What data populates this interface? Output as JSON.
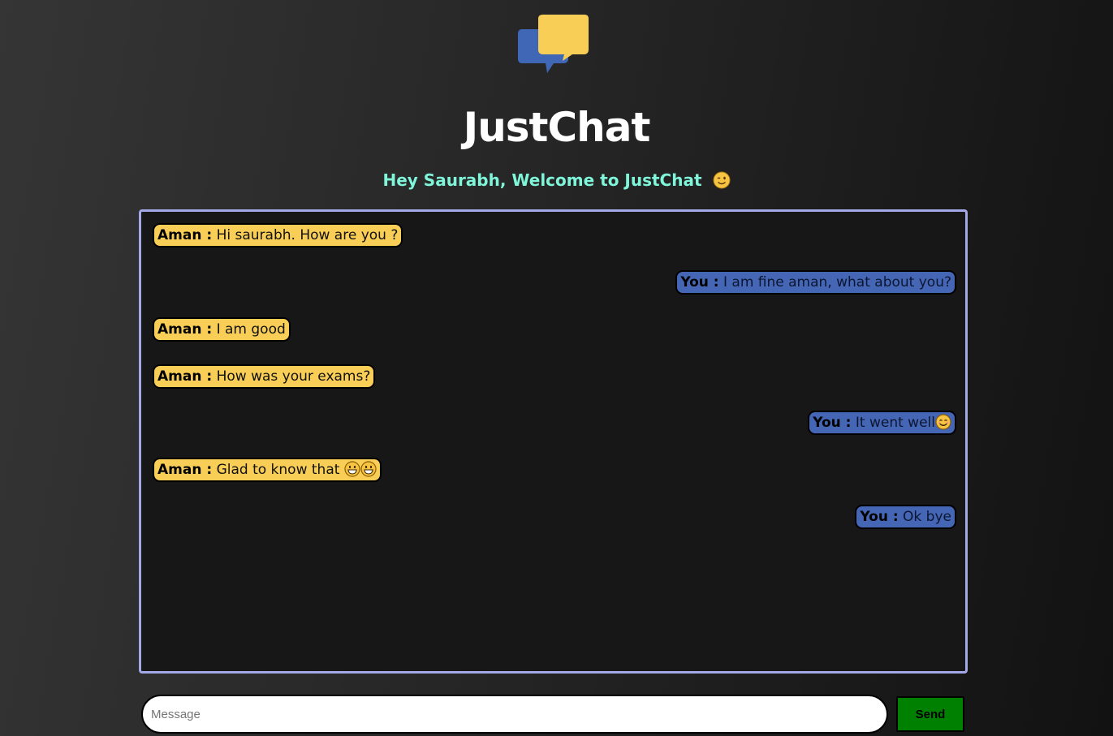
{
  "app": {
    "title": "JustChat",
    "welcome": "Hey Saurabh, Welcome to JustChat",
    "welcome_icon": "wink-emoji-icon",
    "logo_icon": "chat-bubbles-logo-icon"
  },
  "colors": {
    "welcome_text": "#7ff5d9",
    "chat_border": "#a3a8e6",
    "incoming_bubble": "#f9ce56",
    "outgoing_bubble": "#4466b5",
    "send_button": "#008000"
  },
  "messages": [
    {
      "side": "left",
      "sender": "Aman :",
      "text": "Hi saurabh. How are you ?",
      "emojis": []
    },
    {
      "side": "right",
      "sender": "You :",
      "text": "I am fine aman, what about you?",
      "emojis": []
    },
    {
      "side": "left",
      "sender": "Aman :",
      "text": "I am good",
      "emojis": []
    },
    {
      "side": "left",
      "sender": "Aman :",
      "text": "How was your exams?",
      "emojis": []
    },
    {
      "side": "right",
      "sender": "You :",
      "text": "It went well",
      "emojis": [
        "smiling-face-icon"
      ]
    },
    {
      "side": "left",
      "sender": "Aman :",
      "text": "Glad to know that ",
      "emojis": [
        "grinning-face-icon",
        "grinning-face-icon"
      ]
    },
    {
      "side": "right",
      "sender": "You :",
      "text": "Ok bye",
      "emojis": []
    }
  ],
  "composer": {
    "placeholder": "Message",
    "value": "",
    "send_label": "Send"
  }
}
